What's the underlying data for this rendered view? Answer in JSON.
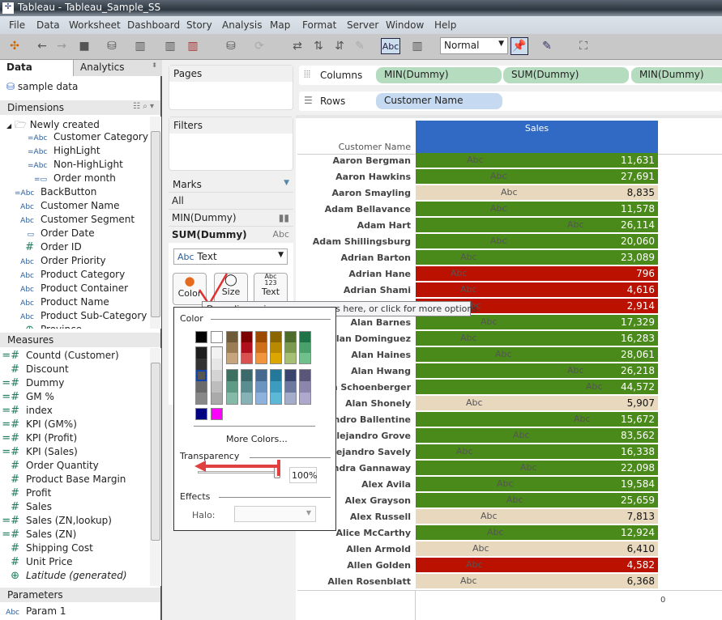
{
  "window": {
    "title": "Tableau - Tableau_Sample_SS"
  },
  "menu": [
    "File",
    "Data",
    "Worksheet",
    "Dashboard",
    "Story",
    "Analysis",
    "Map",
    "Format",
    "Server",
    "Window",
    "Help"
  ],
  "toolbar": {
    "mark_label_button": "Abc",
    "fit_value": "Normal"
  },
  "left": {
    "tabs": [
      "Data",
      "Analytics"
    ],
    "datasource": "sample data",
    "dimensions_header": "Dimensions",
    "folder": "Newly created",
    "folder_items": [
      {
        "type": "=Abc",
        "label": "Customer Category"
      },
      {
        "type": "=Abc",
        "label": "HighLight"
      },
      {
        "type": "=Abc",
        "label": "Non-HighLight"
      },
      {
        "type": "=date",
        "label": "Order month"
      }
    ],
    "dimensions": [
      {
        "type": "=Abc",
        "label": "BackButton"
      },
      {
        "type": "Abc",
        "label": "Customer Name"
      },
      {
        "type": "Abc",
        "label": "Customer Segment"
      },
      {
        "type": "date",
        "label": "Order Date"
      },
      {
        "type": "#",
        "label": "Order ID"
      },
      {
        "type": "Abc",
        "label": "Order Priority"
      },
      {
        "type": "Abc",
        "label": "Product Category"
      },
      {
        "type": "Abc",
        "label": "Product Container"
      },
      {
        "type": "Abc",
        "label": "Product Name"
      },
      {
        "type": "Abc",
        "label": "Product Sub-Category"
      },
      {
        "type": "geo",
        "label": "Province"
      }
    ],
    "measures_header": "Measures",
    "measures": [
      {
        "type": "=#",
        "label": "Countd (Customer)"
      },
      {
        "type": "#",
        "label": "Discount"
      },
      {
        "type": "=#",
        "label": "Dummy"
      },
      {
        "type": "=#",
        "label": "GM %"
      },
      {
        "type": "=#",
        "label": "index"
      },
      {
        "type": "=#",
        "label": "KPI (GM%)"
      },
      {
        "type": "=#",
        "label": "KPI (Profit)"
      },
      {
        "type": "=#",
        "label": "KPI (Sales)"
      },
      {
        "type": "#",
        "label": "Order Quantity"
      },
      {
        "type": "#",
        "label": "Product Base Margin"
      },
      {
        "type": "#",
        "label": "Profit"
      },
      {
        "type": "#",
        "label": "Sales"
      },
      {
        "type": "=#",
        "label": "Sales (ZN,lookup)"
      },
      {
        "type": "=#",
        "label": "Sales (ZN)"
      },
      {
        "type": "#",
        "label": "Shipping Cost"
      },
      {
        "type": "#",
        "label": "Unit Price"
      },
      {
        "type": "geo",
        "label": "Latitude (generated)"
      }
    ],
    "parameters_header": "Parameters",
    "parameters": [
      {
        "type": "Abc",
        "label": "Param 1"
      }
    ]
  },
  "cards": {
    "pages": "Pages",
    "filters": "Filters",
    "marks": "Marks",
    "marks_all": "All",
    "marks_min": "MIN(Dummy)",
    "marks_sum": "SUM(Dummy)",
    "mark_type": "Text",
    "mark_type_icon": "Abc",
    "buttons": [
      "Color",
      "Size",
      "Text"
    ],
    "text_button_icon": "Abc\n123"
  },
  "shelves": {
    "columns_label": "Columns",
    "columns": [
      "MIN(Dummy)",
      "SUM(Dummy)",
      "MIN(Dummy)"
    ],
    "rows_label": "Rows",
    "rows": [
      "Customer Name"
    ]
  },
  "table": {
    "row_header": "Customer Name",
    "column_header": "Sales",
    "axis_zero": "0",
    "mark_text": "Abc",
    "colors": {
      "green": "#4a8a1a",
      "tan": "#e8d9be",
      "red": "#bb1100",
      "header": "#316ac5"
    },
    "rows": [
      {
        "name": "Aaron Bergman",
        "value": "11,631",
        "color": "green"
      },
      {
        "name": "Aaron Hawkins",
        "value": "27,691",
        "color": "green"
      },
      {
        "name": "Aaron Smayling",
        "value": "8,835",
        "color": "tan"
      },
      {
        "name": "Adam Bellavance",
        "value": "11,578",
        "color": "green"
      },
      {
        "name": "Adam Hart",
        "value": "26,114",
        "color": "green"
      },
      {
        "name": "Adam Shillingsburg",
        "value": "20,060",
        "color": "green"
      },
      {
        "name": "Adrian Barton",
        "value": "23,089",
        "color": "green"
      },
      {
        "name": "Adrian Hane",
        "value": "796",
        "color": "red"
      },
      {
        "name": "Adrian Shami",
        "value": "4,616",
        "color": "red"
      },
      {
        "name": "",
        "value": "2,914",
        "color": "red"
      },
      {
        "name": "Alan Barnes",
        "value": "17,329",
        "color": "green"
      },
      {
        "name": "Alan Dominguez",
        "value": "16,283",
        "color": "green"
      },
      {
        "name": "Alan Haines",
        "value": "28,061",
        "color": "green"
      },
      {
        "name": "Alan Hwang",
        "value": "26,218",
        "color": "green"
      },
      {
        "name": "Alan Schoenberger",
        "value": "44,572",
        "color": "green"
      },
      {
        "name": "Alan Shonely",
        "value": "5,907",
        "color": "tan"
      },
      {
        "name": "Alejandro Ballentine",
        "value": "15,672",
        "color": "green"
      },
      {
        "name": "Alejandro Grove",
        "value": "83,562",
        "color": "green"
      },
      {
        "name": "Alejandro Savely",
        "value": "16,338",
        "color": "green"
      },
      {
        "name": "Alessandra Gannaway",
        "value": "22,098",
        "color": "green"
      },
      {
        "name": "Alex Avila",
        "value": "19,584",
        "color": "green"
      },
      {
        "name": "Alex Grayson",
        "value": "25,659",
        "color": "green"
      },
      {
        "name": "Alex Russell",
        "value": "7,813",
        "color": "tan"
      },
      {
        "name": "Alice McCarthy",
        "value": "12,924",
        "color": "green"
      },
      {
        "name": "Allen Armold",
        "value": "6,410",
        "color": "tan"
      },
      {
        "name": "Allen Golden",
        "value": "4,582",
        "color": "red"
      },
      {
        "name": "Allen Rosenblatt",
        "value": "6,368",
        "color": "tan"
      }
    ]
  },
  "tooltip": "Drag dimensions or measures here, or click for more options.",
  "color_popup": {
    "color_label": "Color",
    "more_colors": "More Colors...",
    "transparency_label": "Transparency",
    "transparency_value": "100%",
    "effects_label": "Effects",
    "halo_label": "Halo:",
    "selected_swatch": "#555555",
    "top": [
      "#000000",
      "#ffffff"
    ],
    "grays_dark": [
      "#1e1e1e",
      "#333333",
      "#555555",
      "#6a6a6a",
      "#888888"
    ],
    "grays_light": [
      "#f2f2f2",
      "#e6e6e6",
      "#d4d4d4",
      "#bdbdbd",
      "#aaaaaa"
    ],
    "row1": [
      [
        "#6f5a3a",
        "#9a7d55",
        "#c5a47e"
      ],
      [
        "#7d0000",
        "#b0101e",
        "#d85050"
      ],
      [
        "#9b4a00",
        "#d06f1a",
        "#f0953e"
      ],
      [
        "#8b6500",
        "#b98a00",
        "#dba600"
      ],
      [
        "#4d6b2a",
        "#7b9a50",
        "#a5bf74"
      ],
      [
        "#1f7346",
        "#4aa06b",
        "#6fc08a"
      ]
    ],
    "row2": [
      [
        "#3d7060",
        "#5f9a86",
        "#86baa8"
      ],
      [
        "#3c6a6a",
        "#5a8d90",
        "#86b2b6"
      ],
      [
        "#466a8f",
        "#6c94c0",
        "#8fb2dd"
      ],
      [
        "#24789a",
        "#3b9cc0",
        "#5db8d8"
      ],
      [
        "#3a456e",
        "#6c789e",
        "#a3acc8"
      ],
      [
        "#5a567a",
        "#8c86ac",
        "#aea8cc"
      ]
    ],
    "extra": [
      "#000080",
      "#ff00ff"
    ]
  }
}
